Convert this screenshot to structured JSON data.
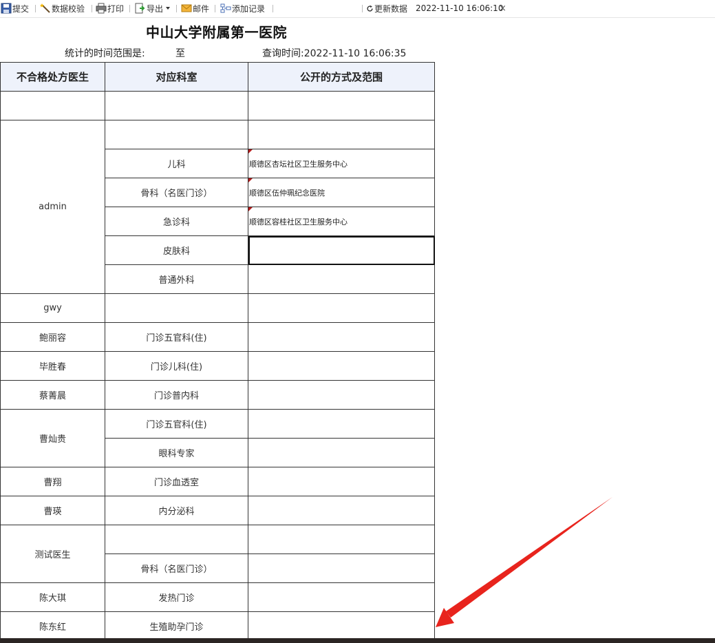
{
  "toolbar": {
    "submit": "提交",
    "validate": "数据校验",
    "print": "打印",
    "export": "导出",
    "mail": "邮件",
    "add_record": "添加记录",
    "refresh": "更新数据",
    "refresh_time": "2022-11-10 16:06:10",
    "close": "×"
  },
  "report": {
    "title": "中山大学附属第一医院",
    "range_label": "统计的时间范围是:",
    "range_to": "至",
    "query_time": "查询时间:2022-11-10 16:06:35"
  },
  "table": {
    "headers": [
      "不合格处方医生",
      "对应科室",
      "公开的方式及范围"
    ],
    "rows": [
      {
        "doctor": "",
        "dept": "",
        "scope": ""
      },
      {
        "doctor": "admin",
        "dept": "",
        "scope": ""
      },
      {
        "dept": "儿科",
        "scope": "顺德区杏坛社区卫生服务中心"
      },
      {
        "dept": "骨科（名医门诊）",
        "scope": "顺德区伍仲珮纪念医院"
      },
      {
        "dept": "急诊科",
        "scope": "顺德区容桂社区卫生服务中心"
      },
      {
        "dept": "皮肤科",
        "scope": ""
      },
      {
        "dept": "普通外科",
        "scope": ""
      },
      {
        "doctor": "gwy",
        "dept": "",
        "scope": ""
      },
      {
        "doctor": "鲍丽容",
        "dept": "门诊五官科(住)",
        "scope": ""
      },
      {
        "doctor": "毕胜春",
        "dept": "门诊儿科(住)",
        "scope": ""
      },
      {
        "doctor": "蔡菁晨",
        "dept": "门诊普内科",
        "scope": ""
      },
      {
        "doctor": "曹灿贵",
        "dept": "门诊五官科(住)",
        "scope": ""
      },
      {
        "dept": "眼科专家",
        "scope": ""
      },
      {
        "doctor": "曹翔",
        "dept": "门诊血透室",
        "scope": ""
      },
      {
        "doctor": "曹瑛",
        "dept": "内分泌科",
        "scope": ""
      },
      {
        "doctor": "测试医生",
        "dept": "",
        "scope": ""
      },
      {
        "dept": "骨科（名医门诊）",
        "scope": ""
      },
      {
        "doctor": "陈大琪",
        "dept": "发热门诊",
        "scope": ""
      },
      {
        "doctor": "陈东红",
        "dept": "生殖助孕门诊",
        "scope": ""
      }
    ]
  },
  "colors": {
    "header_bg": "#eef2fb",
    "comment_flag": "#b31b1b",
    "arrow": "#e8241d"
  },
  "icons": [
    "save-icon",
    "validate-wand-icon",
    "printer-icon",
    "export-icon",
    "mail-icon",
    "add-record-icon",
    "refresh-icon",
    "close-icon",
    "comment-flag-icon"
  ]
}
